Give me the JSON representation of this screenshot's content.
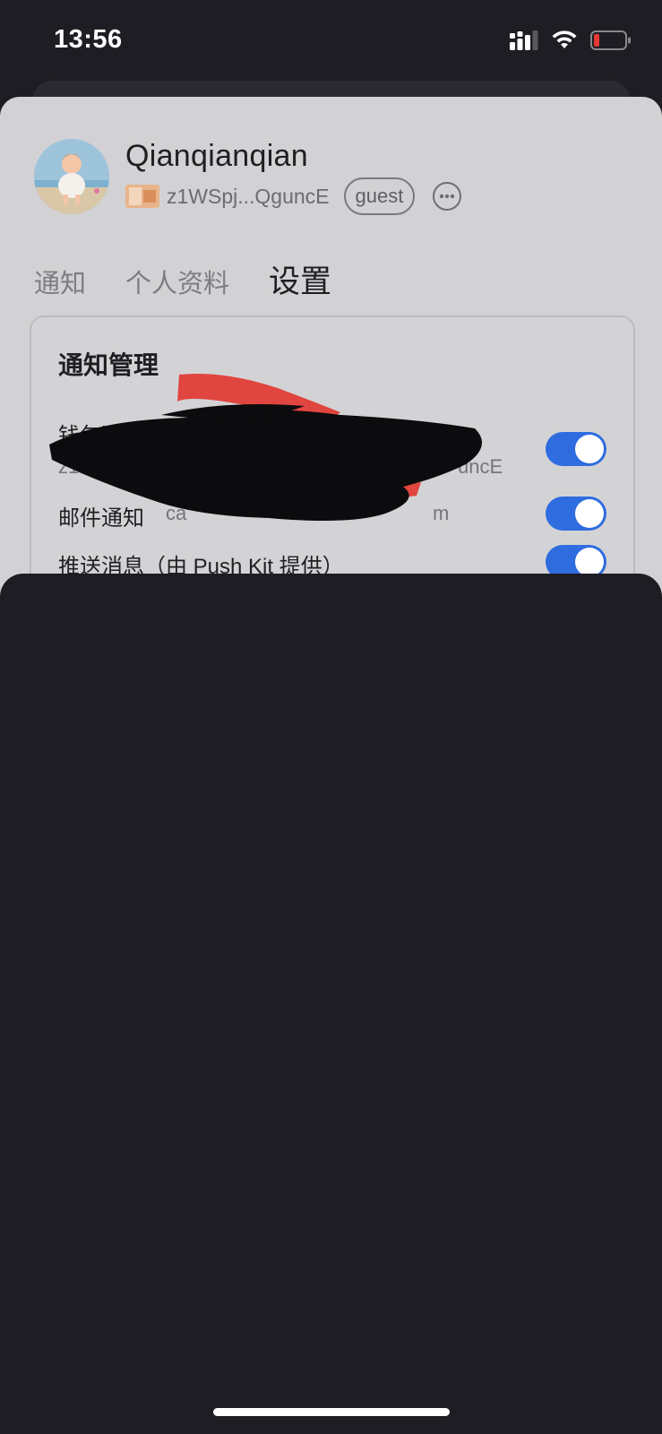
{
  "status_bar": {
    "time": "13:56",
    "icons": [
      "cellular-signal-icon",
      "wifi-icon",
      "battery-low-icon"
    ],
    "battery_color": "#e53935"
  },
  "profile": {
    "username": "Qianqianqian",
    "wallet_address": "z1WSpj...QguncE",
    "role_badge": "guest",
    "more_icon": "more-horizontal-icon"
  },
  "tabs": [
    {
      "label": "通知",
      "active": false
    },
    {
      "label": "个人资料",
      "active": false
    },
    {
      "label": "设置",
      "active": true
    }
  ],
  "notification_settings": {
    "title": "通知管理",
    "items": [
      {
        "label": "钱包通知",
        "sub": "z1W",
        "sub_suffix": "uncE",
        "enabled": true
      },
      {
        "label": "邮件通知",
        "sub": "ca",
        "sub_suffix": "m",
        "enabled": true
      },
      {
        "label": "推送消息（由 Push Kit 提供）",
        "enabled": true
      }
    ]
  },
  "colors": {
    "accent": "#2e6ce0",
    "sheet_background": "#d2d2d4",
    "screen_background": "#1e1d23"
  }
}
